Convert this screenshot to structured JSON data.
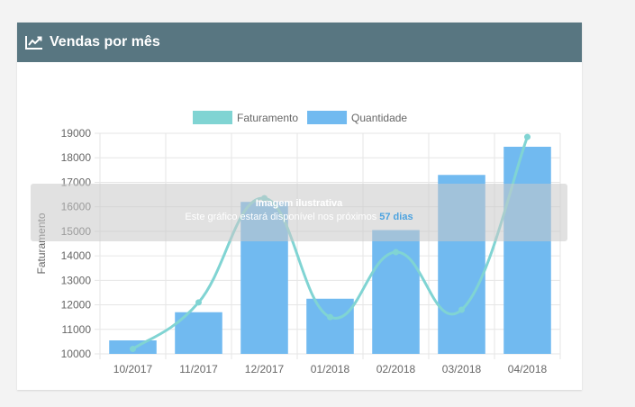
{
  "header": {
    "title": "Vendas por mês",
    "icon": "line-chart-icon",
    "bg_color": "#587681"
  },
  "overlay": {
    "title": "Imagem ilustrativa",
    "message_prefix": "Este gráfico estará disponível nos próximos",
    "highlight": "57 dias",
    "highlight_color": "#4da3e0"
  },
  "chart_data": {
    "type": "bar",
    "categories": [
      "10/2017",
      "11/2017",
      "12/2017",
      "01/2018",
      "02/2018",
      "03/2018",
      "04/2018"
    ],
    "ylabel": "Faturamento",
    "ylim": [
      10000,
      19000
    ],
    "yticks": [
      "10000",
      "11000",
      "12000",
      "13000",
      "14000",
      "15000",
      "16000",
      "17000",
      "18000",
      "19000"
    ],
    "grid": true,
    "legend_position": "top",
    "series": [
      {
        "name": "Faturamento",
        "kind": "line",
        "color": "#80d4d3",
        "values": [
          10200,
          12100,
          16350,
          11500,
          14150,
          11800,
          18850
        ]
      },
      {
        "name": "Quantidade",
        "kind": "bar",
        "color": "#71baf0",
        "values": [
          10550,
          11700,
          16200,
          12250,
          15050,
          17300,
          18450
        ]
      }
    ]
  }
}
